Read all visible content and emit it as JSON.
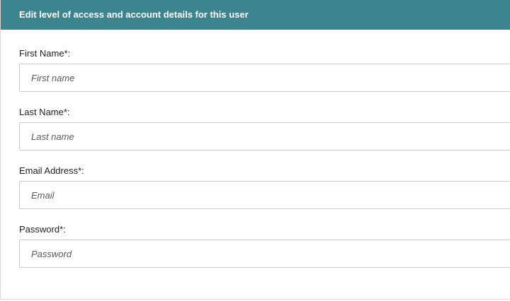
{
  "header": {
    "title": "Edit level of access and account details for this user"
  },
  "form": {
    "first_name": {
      "label": "First Name*:",
      "placeholder": "First name",
      "value": ""
    },
    "last_name": {
      "label": "Last Name*:",
      "placeholder": "Last name",
      "value": ""
    },
    "email": {
      "label": "Email Address*:",
      "placeholder": "Email",
      "value": ""
    },
    "password": {
      "label": "Password*:",
      "placeholder": "Password",
      "value": ""
    }
  },
  "colors": {
    "header_background": "#3a858f",
    "header_text": "#ffffff",
    "input_border": "#cccccc"
  }
}
